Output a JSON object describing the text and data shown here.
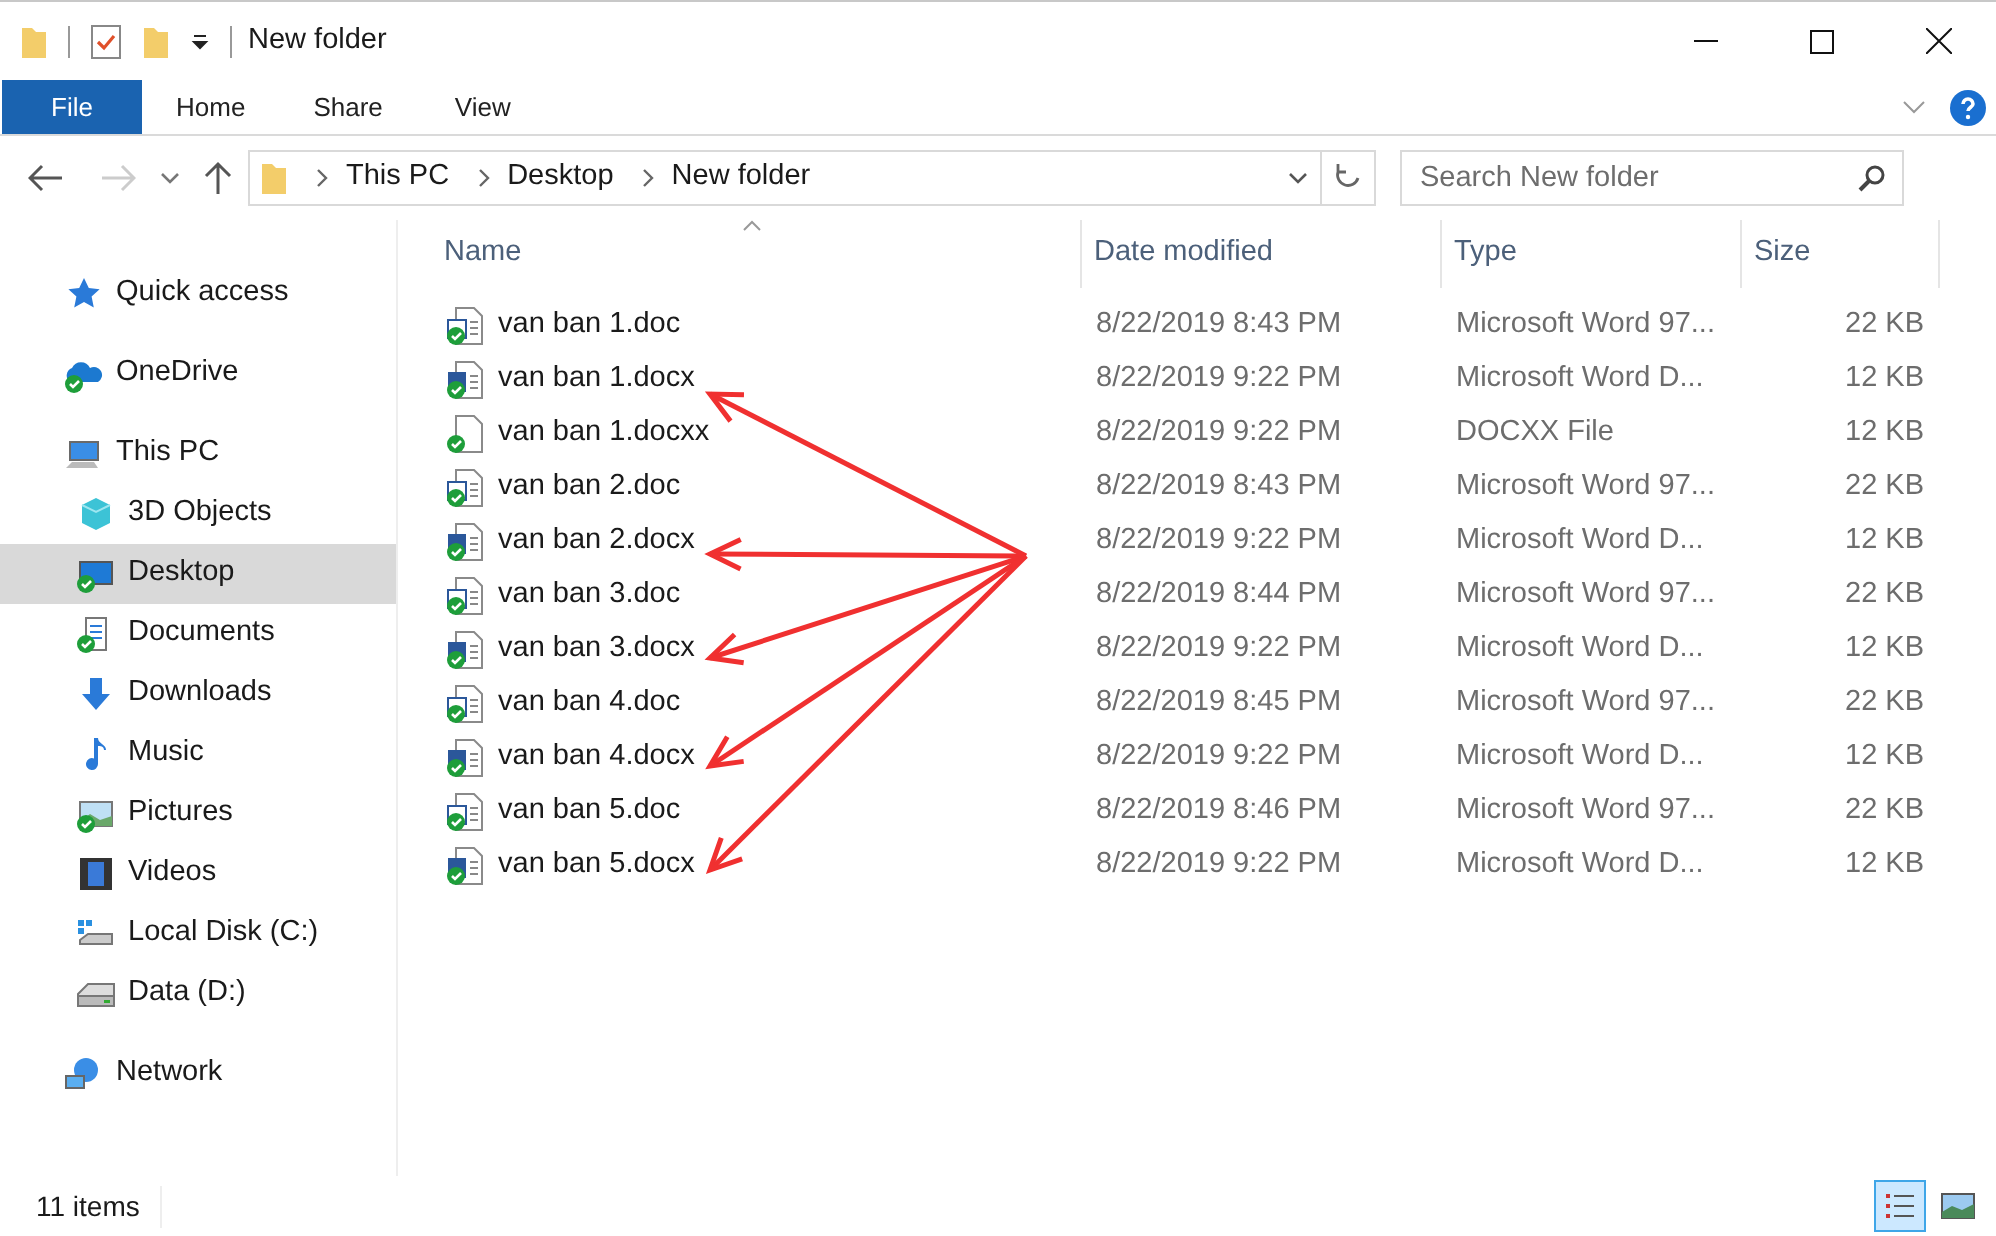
{
  "window": {
    "title": "New folder"
  },
  "ribbon_tabs": [
    {
      "label": "File",
      "selected": true
    },
    {
      "label": "Home",
      "selected": false
    },
    {
      "label": "Share",
      "selected": false
    },
    {
      "label": "View",
      "selected": false
    }
  ],
  "address_bar": {
    "crumbs": [
      "This PC",
      "Desktop",
      "New folder"
    ]
  },
  "search": {
    "placeholder": "Search New folder"
  },
  "sidebar": {
    "items": [
      {
        "label": "Quick access",
        "kind": "star",
        "selected": false
      },
      {
        "label": "OneDrive",
        "kind": "cloud",
        "selected": false
      },
      {
        "label": "This PC",
        "kind": "pc",
        "selected": false,
        "children": [
          {
            "label": "3D Objects",
            "kind": "cube",
            "selected": false
          },
          {
            "label": "Desktop",
            "kind": "desktop",
            "selected": true
          },
          {
            "label": "Documents",
            "kind": "documents",
            "selected": false
          },
          {
            "label": "Downloads",
            "kind": "download",
            "selected": false
          },
          {
            "label": "Music",
            "kind": "music",
            "selected": false
          },
          {
            "label": "Pictures",
            "kind": "pictures",
            "selected": false
          },
          {
            "label": "Videos",
            "kind": "videos",
            "selected": false
          },
          {
            "label": "Local Disk (C:)",
            "kind": "disk",
            "selected": false
          },
          {
            "label": "Data (D:)",
            "kind": "drive",
            "selected": false
          }
        ]
      },
      {
        "label": "Network",
        "kind": "network",
        "selected": false
      }
    ]
  },
  "table": {
    "columns": [
      "Name",
      "Date modified",
      "Type",
      "Size"
    ],
    "rows": [
      {
        "name": "van ban 1.doc",
        "kind": "doc",
        "date": "8/22/2019 8:43 PM",
        "type": "Microsoft Word 97...",
        "size": "22 KB"
      },
      {
        "name": "van ban 1.docx",
        "kind": "docx",
        "date": "8/22/2019 9:22 PM",
        "type": "Microsoft Word D...",
        "size": "12 KB"
      },
      {
        "name": "van ban 1.docxx",
        "kind": "blank",
        "date": "8/22/2019 9:22 PM",
        "type": "DOCXX File",
        "size": "12 KB"
      },
      {
        "name": "van ban 2.doc",
        "kind": "doc",
        "date": "8/22/2019 8:43 PM",
        "type": "Microsoft Word 97...",
        "size": "22 KB"
      },
      {
        "name": "van ban 2.docx",
        "kind": "docx",
        "date": "8/22/2019 9:22 PM",
        "type": "Microsoft Word D...",
        "size": "12 KB"
      },
      {
        "name": "van ban 3.doc",
        "kind": "doc",
        "date": "8/22/2019 8:44 PM",
        "type": "Microsoft Word 97...",
        "size": "22 KB"
      },
      {
        "name": "van ban 3.docx",
        "kind": "docx",
        "date": "8/22/2019 9:22 PM",
        "type": "Microsoft Word D...",
        "size": "12 KB"
      },
      {
        "name": "van ban 4.doc",
        "kind": "doc",
        "date": "8/22/2019 8:45 PM",
        "type": "Microsoft Word 97...",
        "size": "22 KB"
      },
      {
        "name": "van ban 4.docx",
        "kind": "docx",
        "date": "8/22/2019 9:22 PM",
        "type": "Microsoft Word D...",
        "size": "12 KB"
      },
      {
        "name": "van ban 5.doc",
        "kind": "doc",
        "date": "8/22/2019 8:46 PM",
        "type": "Microsoft Word 97...",
        "size": "22 KB"
      },
      {
        "name": "van ban 5.docx",
        "kind": "docx",
        "date": "8/22/2019 9:22 PM",
        "type": "Microsoft Word D...",
        "size": "12 KB"
      }
    ]
  },
  "status_bar": {
    "count": "11 items",
    "views": [
      {
        "kind": "details",
        "selected": true
      },
      {
        "kind": "large",
        "selected": false
      }
    ]
  }
}
